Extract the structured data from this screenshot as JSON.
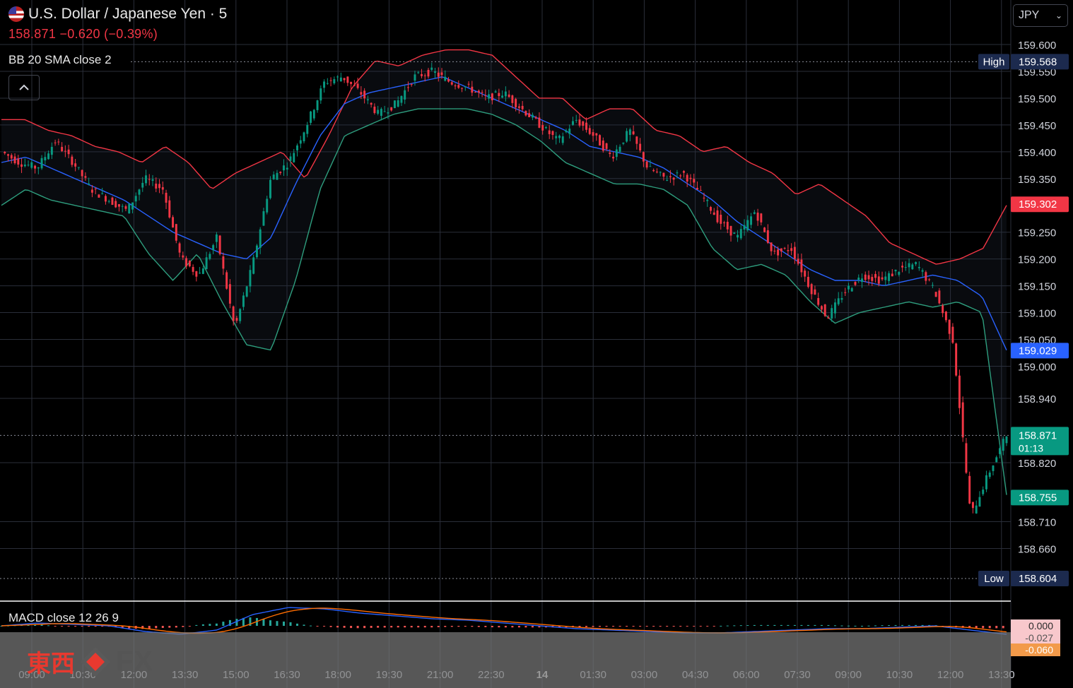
{
  "header": {
    "symbol_title": "U.S. Dollar / Japanese Yen · 5",
    "last": "158.871",
    "change": "−0.620",
    "change_pct": "(−0.39%)",
    "indicator": "BB 20 SMA close 2",
    "macd_label": "MACD close 12 26 9",
    "currency_select": "JPY",
    "collapse_icon": "chevron-up-icon"
  },
  "logo": {
    "cn": "東西",
    "fx": "FX"
  },
  "colors": {
    "up": "#089981",
    "down": "#f23645",
    "bb_upper": "#f23645",
    "bb_lower": "#2e9e7e",
    "bb_mid": "#2962ff",
    "macd": "#2962ff",
    "signal": "#ff6d00",
    "grid": "#2a2e39"
  },
  "chart_data": {
    "type": "candlestick",
    "y_ticks": [
      "159.600",
      "159.550",
      "159.500",
      "159.450",
      "159.400",
      "159.350",
      "159.250",
      "159.200",
      "159.150",
      "159.100",
      "159.050",
      "159.000",
      "158.940",
      "158.820",
      "158.710",
      "158.660"
    ],
    "x_ticks": [
      "09:00",
      "10:30",
      "12:00",
      "13:30",
      "15:00",
      "16:30",
      "18:00",
      "19:30",
      "21:00",
      "22:30",
      "14",
      "01:30",
      "03:00",
      "04:30",
      "06:00",
      "07:30",
      "09:00",
      "10:30",
      "12:00",
      "13:30"
    ],
    "price_badges": [
      {
        "label": "High",
        "value": "159.568",
        "kind": "high"
      },
      {
        "label": "",
        "value": "159.302",
        "kind": "upper"
      },
      {
        "label": "",
        "value": "159.029",
        "kind": "mid"
      },
      {
        "label": "",
        "value": "158.871",
        "kind": "last",
        "countdown": "01:13"
      },
      {
        "label": "",
        "value": "158.755",
        "kind": "lower"
      },
      {
        "label": "Low",
        "value": "158.604",
        "kind": "low"
      }
    ],
    "macd_badges": [
      "0.000",
      "-0.027",
      "-0.060"
    ],
    "ylim": [
      158.6,
      159.62
    ],
    "close_path": [
      159.4,
      159.38,
      159.37,
      159.42,
      159.38,
      159.33,
      159.31,
      159.29,
      159.35,
      159.33,
      159.2,
      159.17,
      159.24,
      159.07,
      159.19,
      159.35,
      159.38,
      159.45,
      159.53,
      159.54,
      159.51,
      159.47,
      159.49,
      159.54,
      159.55,
      159.53,
      159.52,
      159.5,
      159.51,
      159.48,
      159.45,
      159.42,
      159.46,
      159.43,
      159.39,
      159.44,
      159.37,
      159.35,
      159.36,
      159.32,
      159.27,
      159.24,
      159.29,
      159.21,
      159.22,
      159.15,
      159.09,
      159.14,
      159.17,
      159.16,
      159.18,
      159.19,
      159.14,
      159.05,
      158.72,
      158.8,
      158.871
    ],
    "upper_path": [
      159.46,
      159.46,
      159.44,
      159.43,
      159.41,
      159.4,
      159.38,
      159.41,
      159.38,
      159.33,
      159.36,
      159.38,
      159.4,
      159.35,
      159.43,
      159.52,
      159.57,
      159.56,
      159.58,
      159.59,
      159.59,
      159.58,
      159.54,
      159.5,
      159.5,
      159.46,
      159.48,
      159.48,
      159.44,
      159.43,
      159.4,
      159.41,
      159.38,
      159.36,
      159.32,
      159.34,
      159.31,
      159.28,
      159.23,
      159.21,
      159.19,
      159.2,
      159.22,
      159.3
    ],
    "lower_path": [
      159.3,
      159.33,
      159.31,
      159.3,
      159.29,
      159.28,
      159.21,
      159.16,
      159.21,
      159.12,
      159.04,
      159.03,
      159.16,
      159.33,
      159.43,
      159.45,
      159.47,
      159.48,
      159.48,
      159.48,
      159.47,
      159.45,
      159.42,
      159.38,
      159.36,
      159.34,
      159.34,
      159.33,
      159.3,
      159.22,
      159.18,
      159.19,
      159.17,
      159.12,
      159.08,
      159.1,
      159.11,
      159.12,
      159.11,
      159.12,
      159.1,
      158.76
    ],
    "mid_path": [
      159.38,
      159.39,
      159.37,
      159.35,
      159.33,
      159.31,
      159.28,
      159.25,
      159.23,
      159.21,
      159.2,
      159.24,
      159.34,
      159.43,
      159.49,
      159.51,
      159.52,
      159.53,
      159.54,
      159.52,
      159.5,
      159.48,
      159.46,
      159.44,
      159.41,
      159.4,
      159.39,
      159.37,
      159.34,
      159.31,
      159.27,
      159.24,
      159.21,
      159.18,
      159.16,
      159.16,
      159.15,
      159.16,
      159.17,
      159.16,
      159.13,
      159.03
    ]
  }
}
